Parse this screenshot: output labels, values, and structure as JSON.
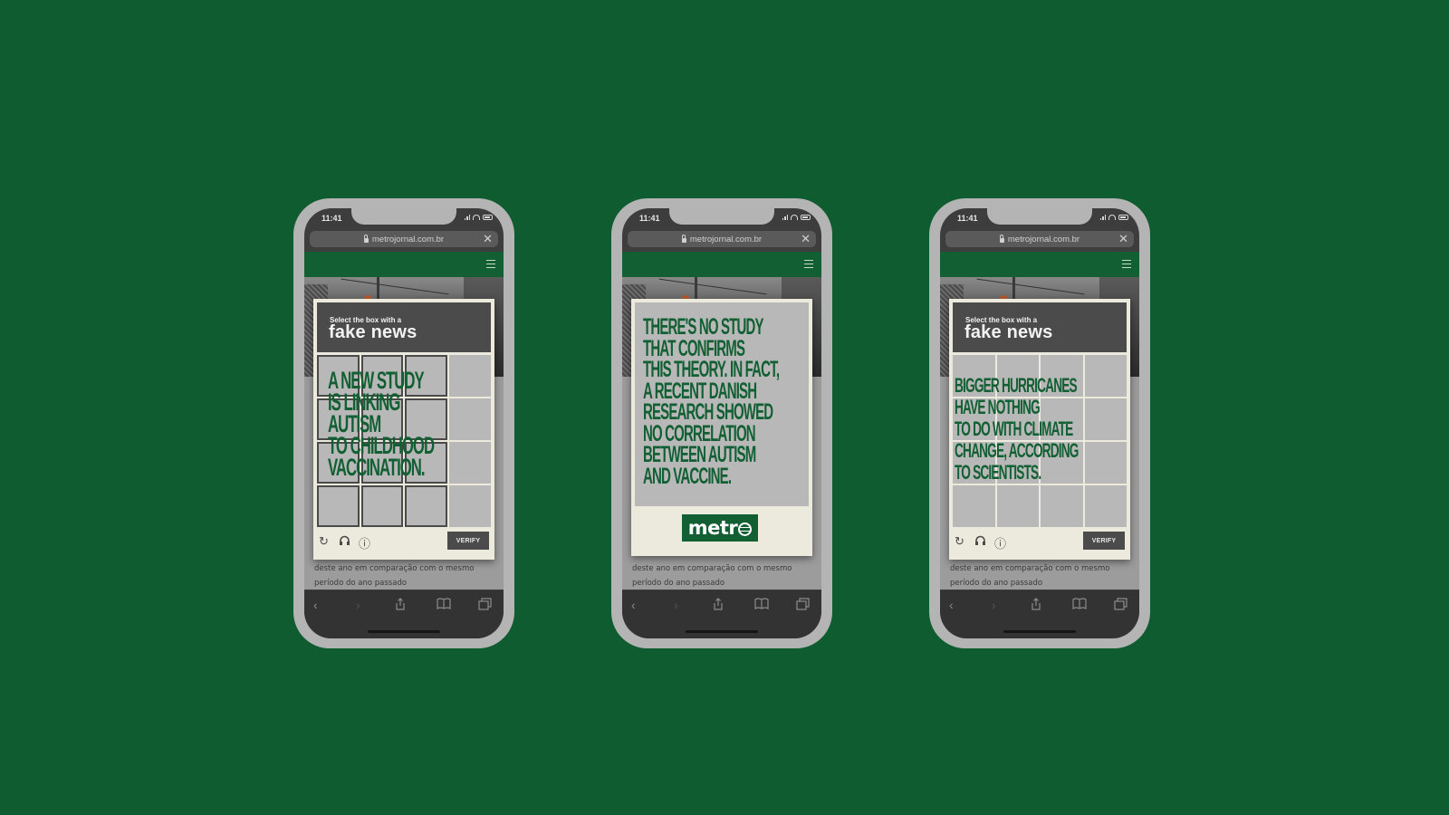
{
  "colors": {
    "background": "#105c31",
    "brand_green": "#115f33",
    "card_bg": "#ece9dd",
    "tile_gray": "#b8b8b8",
    "dark_header": "#4b4b4b"
  },
  "phones": [
    {
      "status_time": "11:41",
      "url": "metrojornal.com.br",
      "captcha": {
        "prompt_small": "Select the box with a",
        "prompt_big": "fake news",
        "headline_lines": [
          "A NEW STUDY",
          "IS LINKING",
          "AUTISM",
          "TO CHILDHOOD",
          "VACCINATION."
        ],
        "selected_cells": [
          0,
          1,
          2,
          4,
          5,
          6,
          8,
          9,
          10,
          12,
          13,
          14
        ],
        "verify_label": "VERIFY"
      },
      "article_text": "deste ano em comparação com o mesmo período do ano passado"
    },
    {
      "status_time": "11:41",
      "url": "metrojornal.com.br",
      "answer": {
        "lines": [
          "THERE'S NO STUDY",
          "THAT CONFIRMS",
          "THIS THEORY. IN FACT,",
          "A RECENT DANISH",
          "RESEARCH SHOWED",
          "NO CORRELATION",
          "BETWEEN AUTISM",
          "AND VACCINE."
        ],
        "logo_text": "metr"
      },
      "article_text": "deste ano em comparação com o mesmo período do ano passado"
    },
    {
      "status_time": "11:41",
      "url": "metrojornal.com.br",
      "captcha": {
        "prompt_small": "Select the box with a",
        "prompt_big": "fake news",
        "headline_lines": [
          "BIGGER HURRICANES",
          "HAVE NOTHING",
          "TO DO WITH CLIMATE",
          "CHANGE, ACCORDING",
          "TO SCIENTISTS."
        ],
        "selected_cells": [],
        "verify_label": "VERIFY"
      },
      "article_text": "deste ano em comparação com o mesmo período do ano passado"
    }
  ],
  "icons": {
    "close": "✕",
    "refresh": "↻",
    "audio": "headphones-icon",
    "info": "ⓘ",
    "back": "‹",
    "forward": "›"
  }
}
